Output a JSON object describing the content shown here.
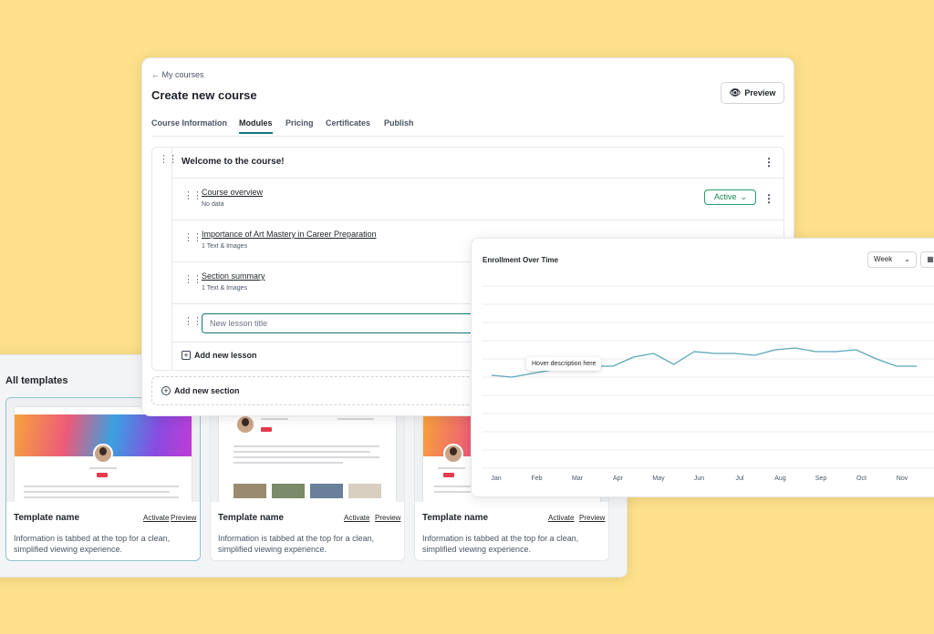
{
  "templates": {
    "title": "All templates",
    "cards": [
      {
        "name": "Template name",
        "activate": "Activate",
        "preview": "Preview",
        "description": "Information is tabbed at the top for a clean, simplified viewing experience."
      },
      {
        "name": "Template name",
        "activate": "Activate",
        "preview": "Preview",
        "description": "Information is tabbed at the top for a clean, simplified viewing experience."
      },
      {
        "name": "Template name",
        "activate": "Activate",
        "preview": "Preview",
        "description": "Information is tabbed at the top for a clean, simplified viewing experience."
      }
    ]
  },
  "course": {
    "back_label": "My courses",
    "title": "Create new course",
    "preview_label": "Preview",
    "tabs": [
      "Course Information",
      "Modules",
      "Pricing",
      "Certificates",
      "Publish"
    ],
    "active_tab": "Modules",
    "section_title": "Welcome to the course!",
    "lessons": [
      {
        "title": "Course overview",
        "subtitle": "No data",
        "status": "Active"
      },
      {
        "title": "Importance of Art Mastery in Career Preparation",
        "subtitle": "1 Text & Images"
      },
      {
        "title": "Section summary",
        "subtitle": "1 Text & Images"
      }
    ],
    "new_lesson_placeholder": "New lesson title",
    "add_lesson_label": "Add new lesson",
    "add_section_label": "Add new section"
  },
  "enrollment": {
    "title": "Enrollment Over Time",
    "period": "Week",
    "tooltip": "Hover description here",
    "line_color": "#5aa7b8"
  },
  "chart_data": {
    "type": "line",
    "title": "Enrollment Over Time",
    "categories": [
      "Jan",
      "Feb",
      "Mar",
      "Apr",
      "May",
      "Jun",
      "Jul",
      "Aug",
      "Sep",
      "Oct",
      "Nov"
    ],
    "x": [
      "Jan",
      "",
      "Feb",
      "",
      "Mar",
      "",
      "Apr",
      "",
      "May",
      "",
      "Jun",
      "",
      "Jul",
      "",
      "Aug",
      "",
      "Sep",
      "",
      "Oct",
      "",
      "Nov",
      ""
    ],
    "series": [
      {
        "values": [
          51,
          50,
          52,
          54,
          56,
          56,
          56,
          61,
          63,
          57,
          64,
          63,
          63,
          62,
          65,
          66,
          64,
          64,
          65,
          60,
          56,
          56
        ]
      }
    ],
    "ylim": [
      0,
      100
    ],
    "grid": true
  }
}
